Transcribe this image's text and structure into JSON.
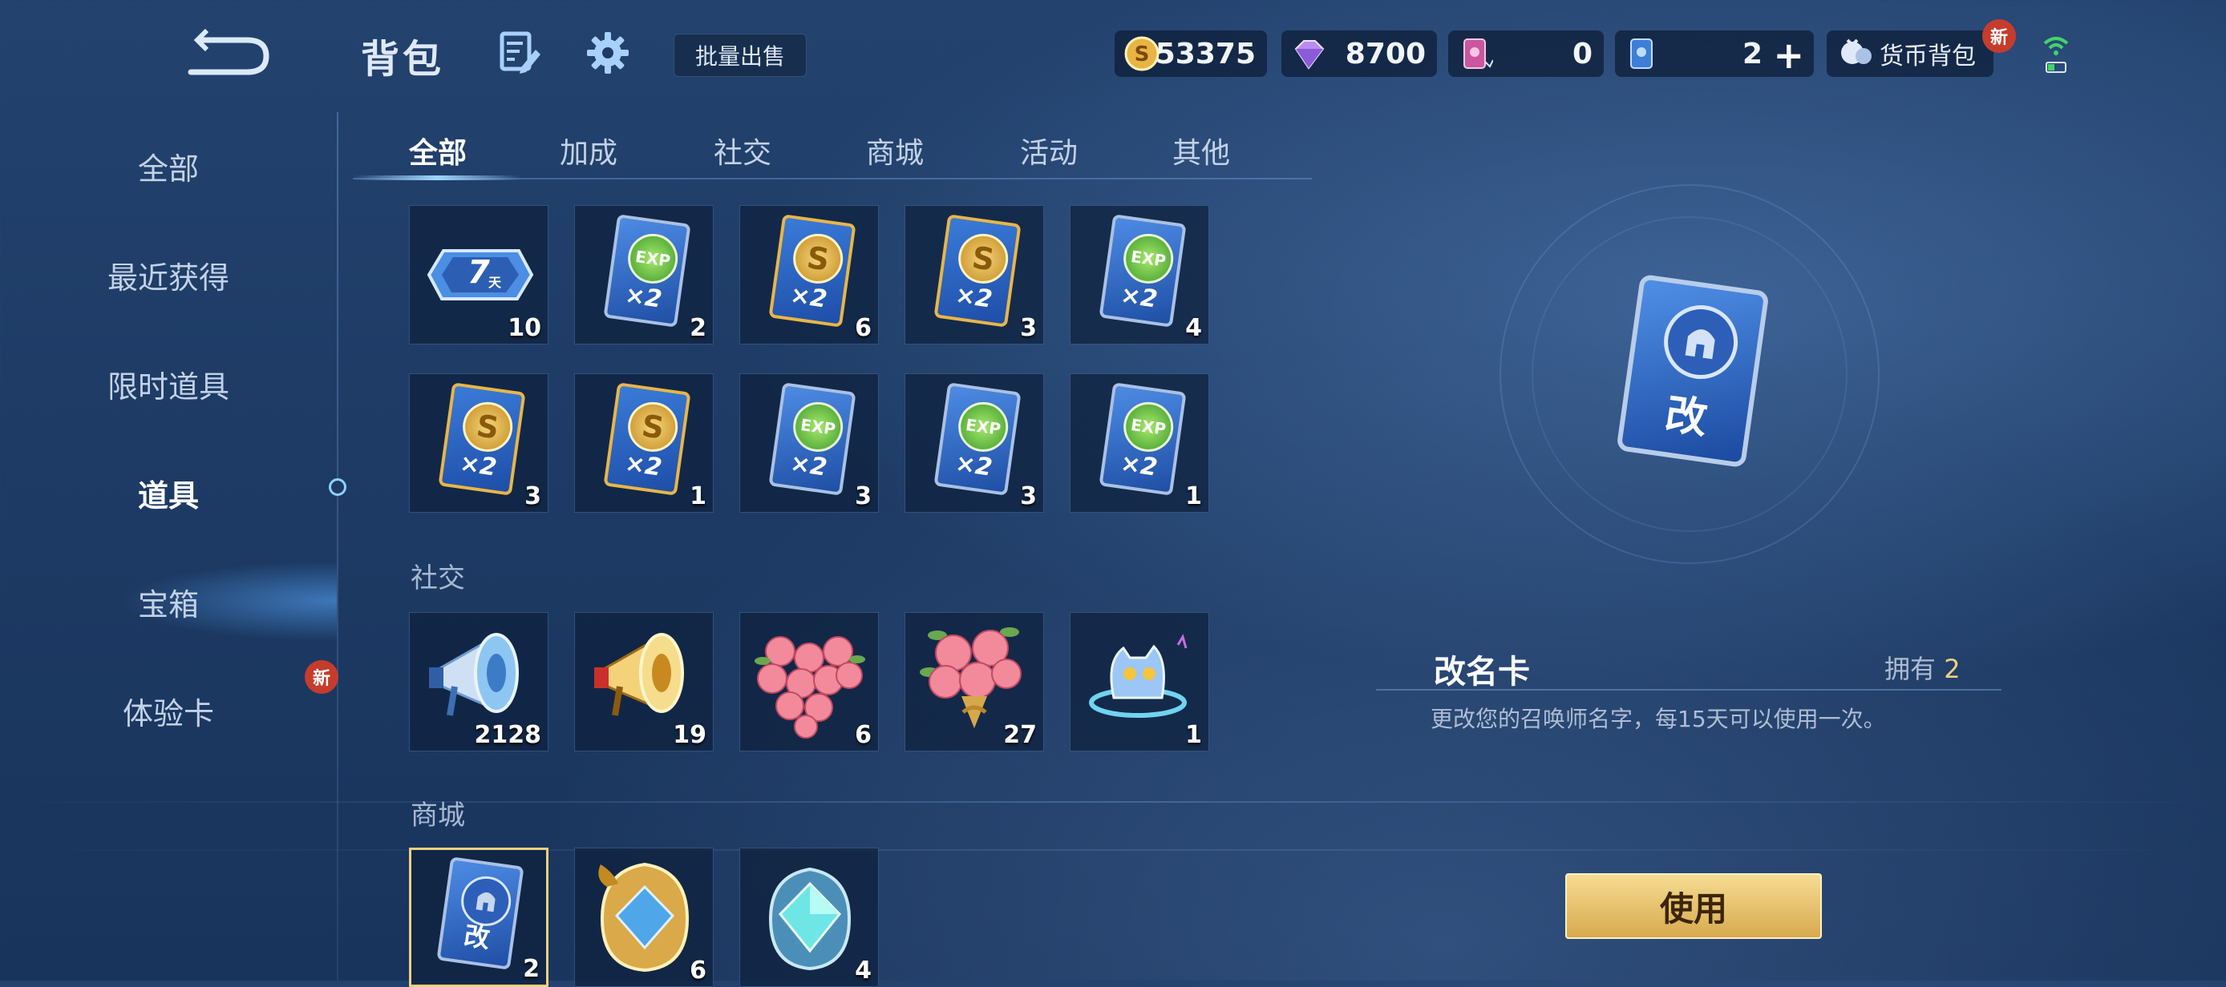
{
  "header": {
    "title": "背包",
    "batch_sell": "批量出售",
    "wallet_label": "货币背包",
    "new_badge": "新"
  },
  "currencies": [
    {
      "icon": "gold-coin-icon",
      "value": "53375"
    },
    {
      "icon": "diamond-icon",
      "value": "8700"
    },
    {
      "icon": "pink-ticket-icon",
      "value": "0"
    },
    {
      "icon": "blue-ticket-icon",
      "value": "2"
    }
  ],
  "sidebar": {
    "items": [
      {
        "label": "全部"
      },
      {
        "label": "最近获得"
      },
      {
        "label": "限时道具"
      },
      {
        "label": "道具"
      },
      {
        "label": "宝箱"
      },
      {
        "label": "体验卡"
      }
    ],
    "active_index": 3,
    "new_badge": "新"
  },
  "tabs": [
    {
      "label": "全部"
    },
    {
      "label": "加成"
    },
    {
      "label": "社交"
    },
    {
      "label": "商城"
    },
    {
      "label": "活动"
    },
    {
      "label": "其他"
    }
  ],
  "sections": {
    "bonus_items": [
      {
        "icon": "7-day-card-icon",
        "count": "10"
      },
      {
        "icon": "exp-double-card-icon",
        "count": "2"
      },
      {
        "icon": "gold-double-card-icon",
        "count": "6"
      },
      {
        "icon": "gold-double-card-icon",
        "count": "3"
      },
      {
        "icon": "exp-double-card-icon",
        "count": "4"
      },
      {
        "icon": "gold-double-card-icon",
        "count": "3"
      },
      {
        "icon": "gold-double-card-icon",
        "count": "1"
      },
      {
        "icon": "exp-double-card-icon",
        "count": "3"
      },
      {
        "icon": "exp-double-card-icon",
        "count": "3"
      },
      {
        "icon": "exp-double-card-icon",
        "count": "1"
      }
    ],
    "social_label": "社交",
    "social_items": [
      {
        "icon": "blue-horn-icon",
        "count": "2128"
      },
      {
        "icon": "gold-horn-icon",
        "count": "19"
      },
      {
        "icon": "rose-heart-icon",
        "count": "6"
      },
      {
        "icon": "rose-bouquet-icon",
        "count": "27"
      },
      {
        "icon": "blue-pet-icon",
        "count": "1"
      }
    ],
    "mall_label": "商城",
    "mall_items": [
      {
        "icon": "rename-card-icon",
        "count": "2"
      },
      {
        "icon": "gold-crystal-icon",
        "count": "6"
      },
      {
        "icon": "cyan-crystal-icon",
        "count": "4"
      }
    ]
  },
  "card_text": {
    "exp": "EXP",
    "coin": "S",
    "x2": "×2",
    "seven": "7",
    "day": "天",
    "rename": "改"
  },
  "detail": {
    "name": "改名卡",
    "own_label": "拥有",
    "own_count": "2",
    "description": "更改您的召唤师名字，每15天可以使用一次。",
    "use_button": "使用"
  },
  "colors": {
    "accent_gold": "#f1cf80",
    "button_gold": "#d7aa4e",
    "badge_red": "#c63c2c",
    "bg": "#1d3b65"
  }
}
